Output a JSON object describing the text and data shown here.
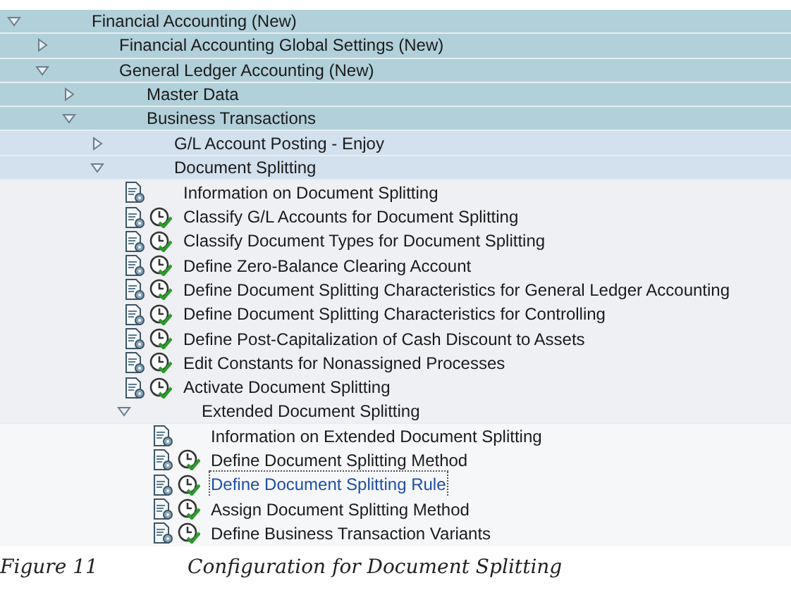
{
  "tree": [
    {
      "kind": "node",
      "label": "Financial Accounting (New)",
      "expanded": true,
      "children": [
        {
          "kind": "node",
          "label": "Financial Accounting Global Settings (New)",
          "expanded": false
        },
        {
          "kind": "node",
          "label": "General Ledger Accounting (New)",
          "expanded": true,
          "children": [
            {
              "kind": "node",
              "label": "Master Data",
              "expanded": false
            },
            {
              "kind": "node",
              "label": "Business Transactions",
              "expanded": true,
              "children": [
                {
                  "kind": "node",
                  "label": "G/L Account Posting - Enjoy",
                  "expanded": false
                },
                {
                  "kind": "node",
                  "label": "Document Splitting",
                  "expanded": true,
                  "children": [
                    {
                      "kind": "activity",
                      "label": "Information on Document Splitting",
                      "executable": false,
                      "selected": false
                    },
                    {
                      "kind": "activity",
                      "label": "Classify G/L Accounts for Document Splitting",
                      "executable": true,
                      "selected": false
                    },
                    {
                      "kind": "activity",
                      "label": "Classify Document Types for Document Splitting",
                      "executable": true,
                      "selected": false
                    },
                    {
                      "kind": "activity",
                      "label": "Define Zero-Balance Clearing Account",
                      "executable": true,
                      "selected": false
                    },
                    {
                      "kind": "activity",
                      "label": "Define Document Splitting Characteristics for General Ledger Accounting",
                      "executable": true,
                      "selected": false
                    },
                    {
                      "kind": "activity",
                      "label": "Define Document Splitting Characteristics for Controlling",
                      "executable": true,
                      "selected": false
                    },
                    {
                      "kind": "activity",
                      "label": "Define Post-Capitalization of Cash Discount to Assets",
                      "executable": true,
                      "selected": false
                    },
                    {
                      "kind": "activity",
                      "label": "Edit Constants for Nonassigned Processes",
                      "executable": true,
                      "selected": false
                    },
                    {
                      "kind": "activity",
                      "label": "Activate Document Splitting",
                      "executable": true,
                      "selected": false
                    },
                    {
                      "kind": "node",
                      "label": "Extended Document Splitting",
                      "expanded": true,
                      "children": [
                        {
                          "kind": "activity",
                          "label": "Information on Extended Document Splitting",
                          "executable": false,
                          "selected": false
                        },
                        {
                          "kind": "activity",
                          "label": "Define Document Splitting Method",
                          "executable": true,
                          "selected": false
                        },
                        {
                          "kind": "activity",
                          "label": "Define Document Splitting Rule",
                          "executable": true,
                          "selected": true
                        },
                        {
                          "kind": "activity",
                          "label": "Assign Document Splitting Method",
                          "executable": true,
                          "selected": false
                        },
                        {
                          "kind": "activity",
                          "label": "Define Business Transaction Variants",
                          "executable": true,
                          "selected": false
                        }
                      ]
                    }
                  ]
                }
              ]
            }
          ]
        }
      ]
    }
  ],
  "caption": {
    "number": "Figure 11",
    "text": "Configuration for Document Splitting"
  }
}
